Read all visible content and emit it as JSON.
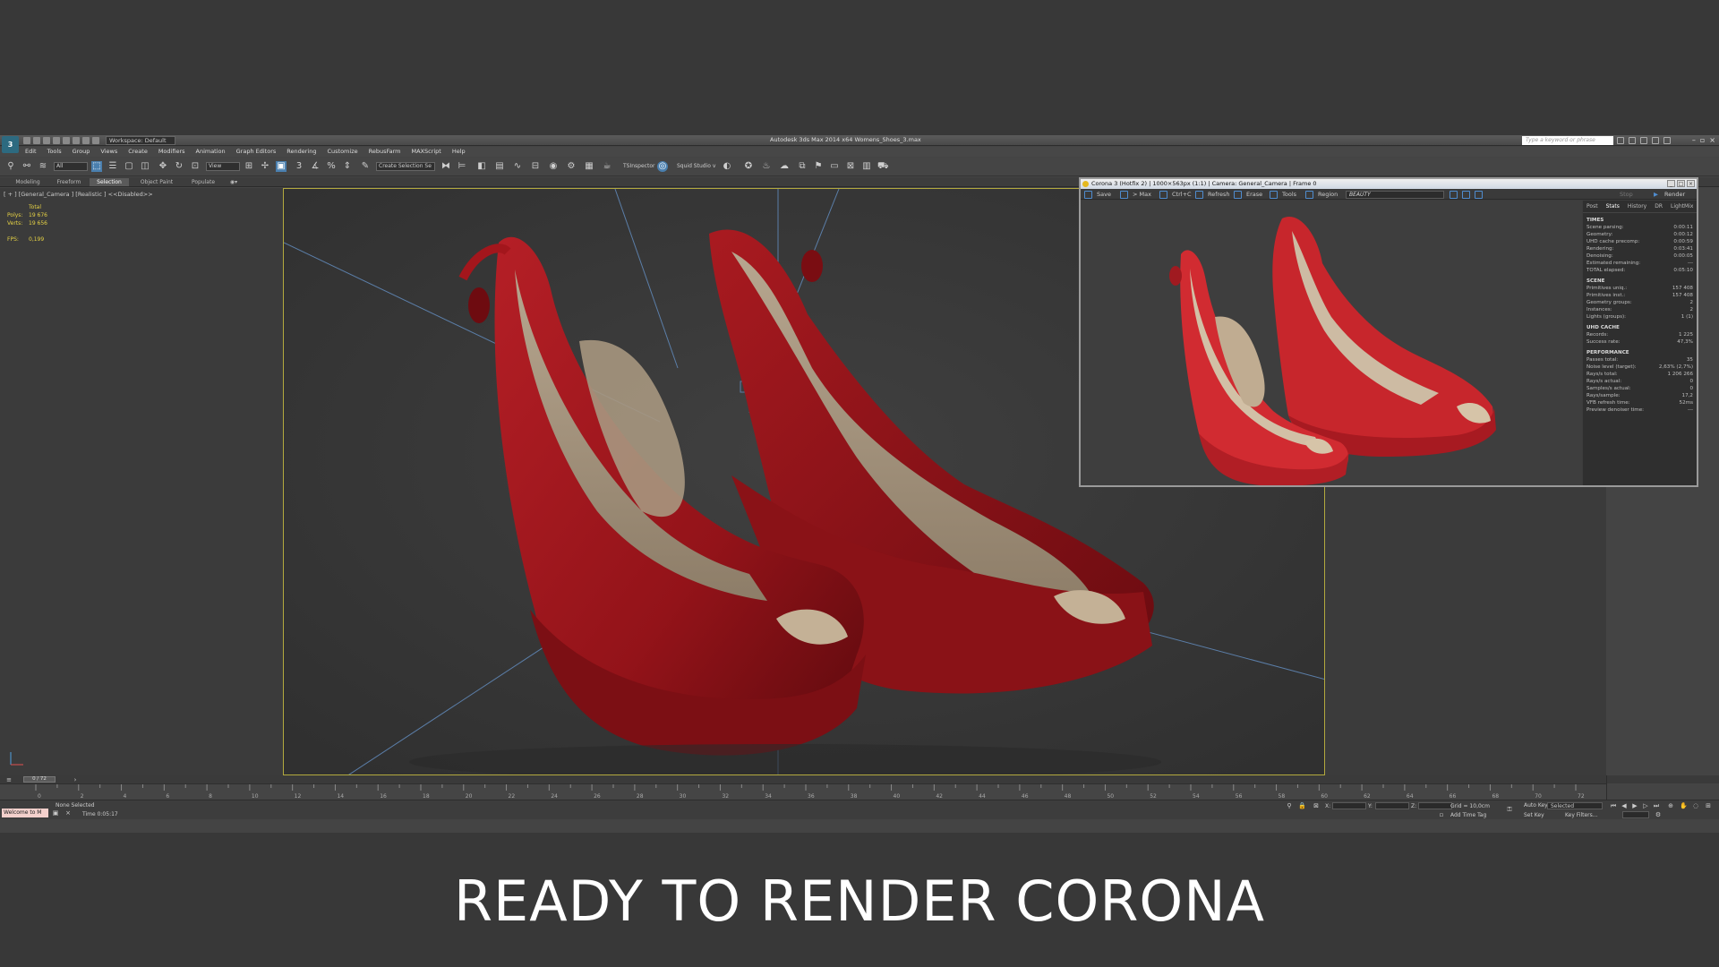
{
  "app": {
    "title": "Autodesk 3ds Max  2014 x64     Womens_Shoes_3.max",
    "logo": "3",
    "workspace": "Workspace: Default",
    "keyword_placeholder": "Type a keyword or phrase",
    "menus": [
      "Edit",
      "Tools",
      "Group",
      "Views",
      "Create",
      "Modifiers",
      "Animation",
      "Graph Editors",
      "Rendering",
      "Customize",
      "RebusFarm",
      "MAXScript",
      "Help"
    ],
    "toolbar": {
      "filter_value": "All",
      "view_value": "View",
      "selection_set_placeholder": "Create Selection Se",
      "tsinspector": "TSInspector",
      "squid_studio": "Squid Studio v"
    },
    "ribbon_tabs": [
      "Modeling",
      "Freeform",
      "Selection",
      "Object Paint",
      "Populate"
    ],
    "ribbon_active": "Selection"
  },
  "viewport": {
    "label": "[ + ] [General_Camera ] [Realistic ]  <<Disabled>>",
    "stats": {
      "header": "Total",
      "polys_label": "Polys:",
      "polys_value": "19 676",
      "verts_label": "Verts:",
      "verts_value": "19 656",
      "fps_label": "FPS:",
      "fps_value": "0,199"
    }
  },
  "vfb": {
    "title": "Corona 3 (Hotfix 2) | 1000×563px (1:1) | Camera: General_Camera | Frame 0",
    "tools": [
      "Save",
      "> Max",
      "Ctrl+C",
      "Refresh",
      "Erase",
      "Tools",
      "Region"
    ],
    "pass": "BEAUTY",
    "stop_label": "Stop",
    "render_label": "Render",
    "tabs": [
      "Post",
      "Stats",
      "History",
      "DR",
      "LightMix"
    ],
    "active_tab": "Stats",
    "sections": [
      {
        "title": "TIMES",
        "rows": [
          [
            "Scene parsing:",
            "0:00:11"
          ],
          [
            "Geometry:",
            "0:00:12"
          ],
          [
            "UHD cache precomp:",
            "0:00:59"
          ],
          [
            "Rendering:",
            "0:03:41"
          ],
          [
            "Denoising:",
            "0:00:05"
          ],
          [
            "Estimated remaining:",
            "---"
          ],
          [
            "TOTAL elapsed:",
            "0:05:10"
          ]
        ]
      },
      {
        "title": "SCENE",
        "rows": [
          [
            "Primitives uniq.:",
            "157 408"
          ],
          [
            "Primitives inst.:",
            "157 408"
          ],
          [
            "Geometry groups:",
            "2"
          ],
          [
            "Instances:",
            "2"
          ],
          [
            "Lights (groups):",
            "1 (1)"
          ]
        ]
      },
      {
        "title": "UHD CACHE",
        "rows": [
          [
            "Records:",
            "1 225"
          ],
          [
            "Success rate:",
            "47,3%"
          ]
        ]
      },
      {
        "title": "PERFORMANCE",
        "rows": [
          [
            "Passes total:",
            "35"
          ],
          [
            "Noise level (target):",
            "2,63% (2,7%)"
          ],
          [
            "Rays/s total:",
            "1 206 266"
          ],
          [
            "Rays/s actual:",
            "0"
          ],
          [
            "Samples/s actual:",
            "0"
          ],
          [
            "Rays/sample:",
            "17,2"
          ],
          [
            "VFB refresh time:",
            "52ms"
          ],
          [
            "Preview denoiser time:",
            "---"
          ]
        ]
      }
    ]
  },
  "timeline": {
    "slider": "0 / 72",
    "ticks": [
      "0",
      "2",
      "4",
      "6",
      "8",
      "10",
      "12",
      "14",
      "16",
      "18",
      "20",
      "22",
      "24",
      "26",
      "28",
      "30",
      "32",
      "34",
      "36",
      "38",
      "40",
      "42",
      "44",
      "46",
      "48",
      "50",
      "52",
      "54",
      "56",
      "58",
      "60",
      "62",
      "64",
      "66",
      "68",
      "70",
      "72"
    ]
  },
  "status": {
    "maxscript": "Welcome to M",
    "none_selected": "None Selected",
    "time": "Time  0:05:17",
    "x_label": "X:",
    "y_label": "Y:",
    "z_label": "Z:",
    "grid": "Grid = 10,0cm",
    "add_time_tag": "Add Time Tag",
    "auto_key": "Auto Key",
    "selected": "Selected",
    "set_key": "Set Key",
    "key_filters": "Key Filters..."
  },
  "caption": "READY TO RENDER  CORONA",
  "colors": {
    "background": "#383838",
    "accent_blue": "#4a7fae",
    "shoe_red": "#a3161c",
    "safe_frame": "#b3a93e"
  }
}
